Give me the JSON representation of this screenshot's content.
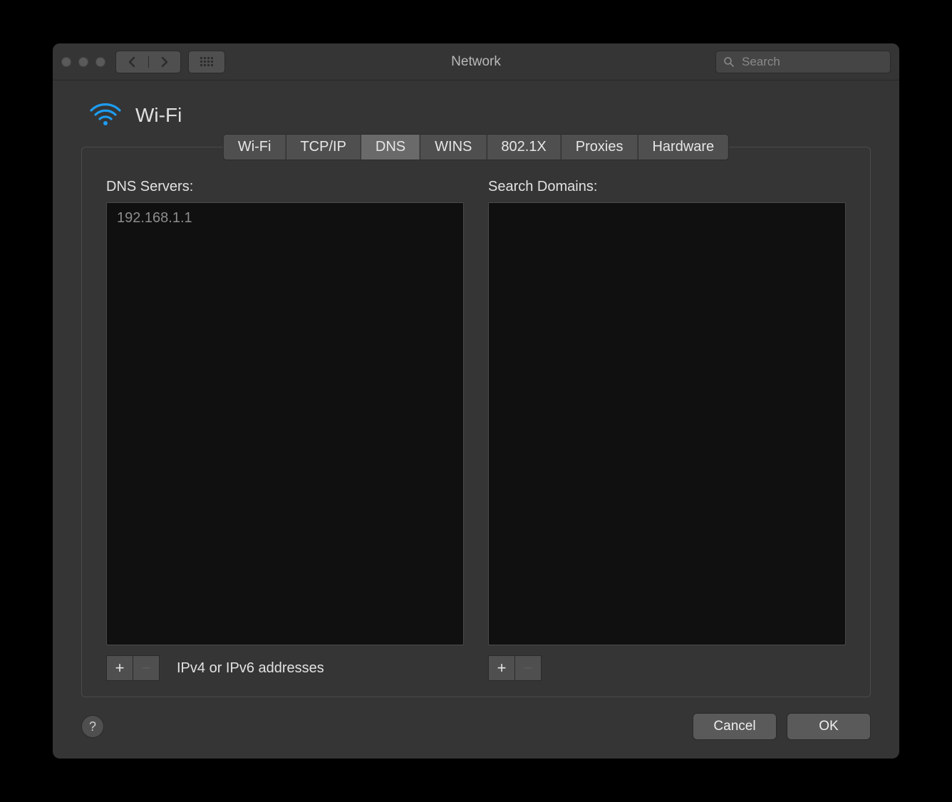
{
  "window": {
    "title": "Network"
  },
  "search": {
    "placeholder": "Search",
    "value": ""
  },
  "header": {
    "interface_name": "Wi-Fi"
  },
  "tabs": [
    {
      "label": "Wi-Fi",
      "active": false
    },
    {
      "label": "TCP/IP",
      "active": false
    },
    {
      "label": "DNS",
      "active": true
    },
    {
      "label": "WINS",
      "active": false
    },
    {
      "label": "802.1X",
      "active": false
    },
    {
      "label": "Proxies",
      "active": false
    },
    {
      "label": "Hardware",
      "active": false
    }
  ],
  "dns": {
    "servers_label": "DNS Servers:",
    "servers": [
      "192.168.1.1"
    ],
    "domains_label": "Search Domains:",
    "domains": [],
    "hint": "IPv4 or IPv6 addresses",
    "add_glyph": "+",
    "remove_glyph": "−"
  },
  "buttons": {
    "cancel": "Cancel",
    "ok": "OK",
    "help": "?"
  }
}
